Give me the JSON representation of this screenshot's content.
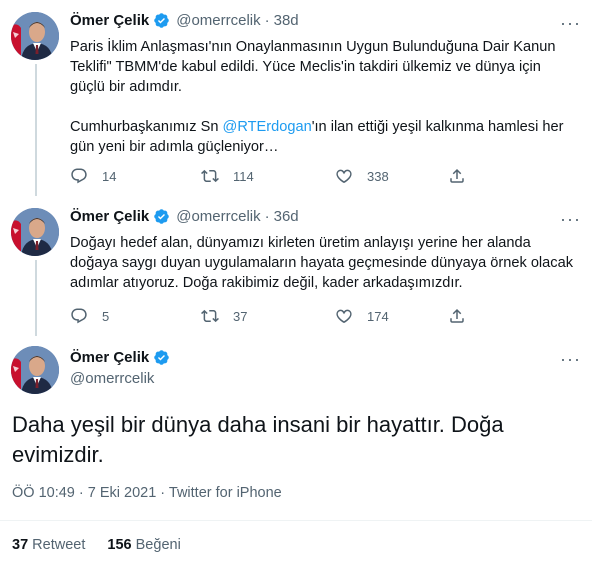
{
  "tweets": [
    {
      "author_name": "Ömer Çelik",
      "handle": "@omerrcelik",
      "time": "38d",
      "paragraph1": "Paris İklim Anlaşması'nın Onaylanmasının Uygun Bulunduğuna Dair Kanun Teklifi\" TBMM'de kabul edildi. Yüce Meclis'in takdiri ülkemiz ve dünya için güçlü bir adımdır.",
      "paragraph2_before": "Cumhurbaşkanımız Sn ",
      "mention": "@RTErdogan",
      "paragraph2_after": "'ın ilan ettiği yeşil kalkınma hamlesi her gün yeni bir adımla güçleniyor…",
      "replies": "14",
      "retweets": "114",
      "likes": "338"
    },
    {
      "author_name": "Ömer Çelik",
      "handle": "@omerrcelik",
      "time": "36d",
      "text": "Doğayı hedef alan, dünyamızı kirleten üretim anlayışı yerine her alanda doğaya saygı duyan uygulamaların hayata geçmesinde dünyaya örnek olacak adımlar atıyoruz. Doğa rakibimiz değil, kader arkadaşımızdır.",
      "replies": "5",
      "retweets": "37",
      "likes": "174"
    }
  ],
  "main_tweet": {
    "author_name": "Ömer Çelik",
    "handle": "@omerrcelik",
    "text": "Daha yeşil bir dünya daha insani bir hayattır. Doğa evimizdir.",
    "timestamp": "ÖÖ 10:49 · 7 Eki 2021 · Twitter for iPhone",
    "retweet_count": "37",
    "retweet_label": "Retweet",
    "like_count": "156",
    "like_label": "Beğeni"
  },
  "colors": {
    "accent": "#1d9bf0",
    "secondary_text": "#536471",
    "divider": "#eff3f4"
  },
  "icons": [
    "reply-icon",
    "retweet-icon",
    "like-icon",
    "share-icon",
    "verified-badge-icon",
    "more-icon"
  ]
}
